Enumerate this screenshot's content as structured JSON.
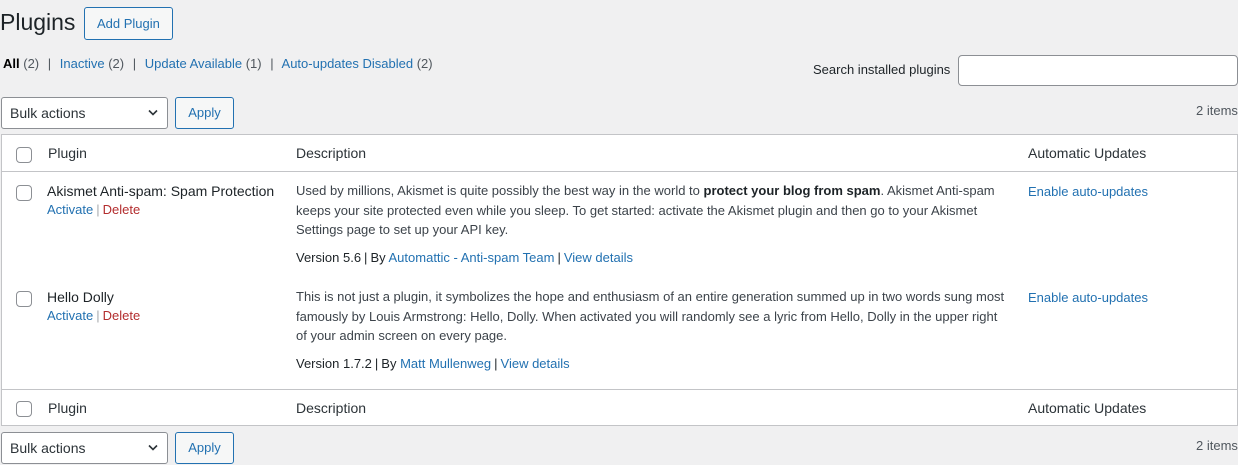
{
  "header": {
    "title": "Plugins",
    "add_button": "Add Plugin"
  },
  "filters": [
    {
      "label": "All",
      "count": "(2)",
      "current": true
    },
    {
      "label": "Inactive",
      "count": "(2)",
      "current": false
    },
    {
      "label": "Update Available",
      "count": "(1)",
      "current": false
    },
    {
      "label": "Auto-updates Disabled",
      "count": "(2)",
      "current": false
    }
  ],
  "search": {
    "label": "Search installed plugins",
    "value": "",
    "placeholder": ""
  },
  "tablenav": {
    "bulk_label": "Bulk actions",
    "apply_label": "Apply",
    "items_count": "2 items"
  },
  "columns": {
    "plugin": "Plugin",
    "description": "Description",
    "auto_updates": "Automatic Updates"
  },
  "plugins": [
    {
      "name": "Akismet Anti-spam: Spam Protection",
      "activate": "Activate",
      "delete": "Delete",
      "desc_before": "Used by millions, Akismet is quite possibly the best way in the world to ",
      "desc_bold": "protect your blog from spam",
      "desc_after": ". Akismet Anti-spam keeps your site protected even while you sleep. To get started: activate the Akismet plugin and then go to your Akismet Settings page to set up your API key.",
      "version": "Version 5.6",
      "by": "By",
      "author": "Automattic - Anti-spam Team",
      "view_details": "View details",
      "auto_update": "Enable auto-updates"
    },
    {
      "name": "Hello Dolly",
      "activate": "Activate",
      "delete": "Delete",
      "desc_before": "This is not just a plugin, it symbolizes the hope and enthusiasm of an entire generation summed up in two words sung most famously by Louis Armstrong: Hello, Dolly. When activated you will randomly see a lyric from Hello, Dolly in the upper right of your admin screen on every page.",
      "desc_bold": "",
      "desc_after": "",
      "version": "Version 1.7.2",
      "by": "By",
      "author": "Matt Mullenweg",
      "view_details": "View details",
      "auto_update": "Enable auto-updates"
    }
  ],
  "colors": {
    "link": "#2271b1",
    "delete": "#b32d2e",
    "background": "#f0f0f1",
    "border": "#c3c4c7"
  },
  "icons": {
    "select_arrow": "chevron-down-icon"
  }
}
